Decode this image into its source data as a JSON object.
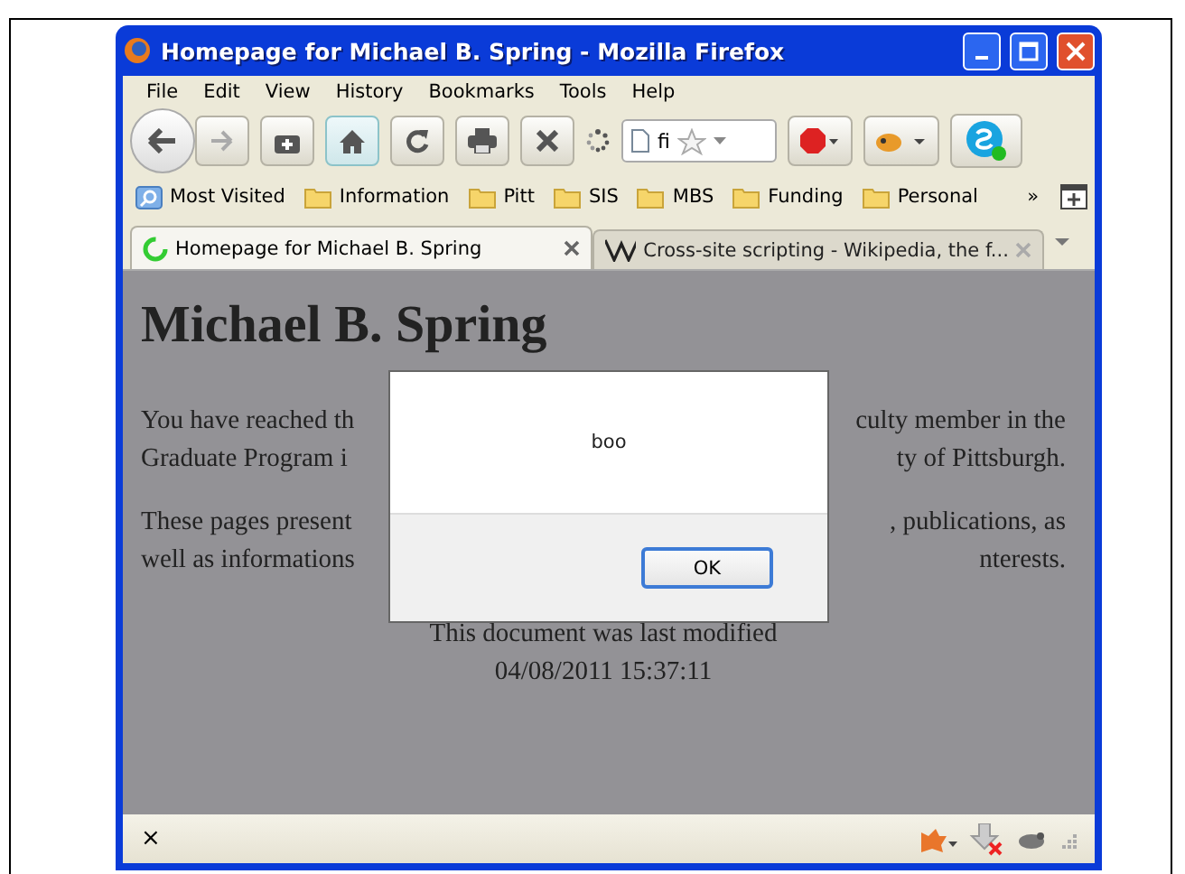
{
  "window": {
    "title": "Homepage for Michael B. Spring - Mozilla Firefox"
  },
  "menu": [
    "File",
    "Edit",
    "View",
    "History",
    "Bookmarks",
    "Tools",
    "Help"
  ],
  "url_bar": {
    "value": "fi"
  },
  "bookmarks": [
    {
      "label": "Most Visited",
      "kind": "smart"
    },
    {
      "label": "Information",
      "kind": "folder"
    },
    {
      "label": "Pitt",
      "kind": "folder"
    },
    {
      "label": "SIS",
      "kind": "folder"
    },
    {
      "label": "MBS",
      "kind": "folder"
    },
    {
      "label": "Funding",
      "kind": "folder"
    },
    {
      "label": "Personal",
      "kind": "folder"
    }
  ],
  "bookmarks_overflow": "»",
  "tabs": [
    {
      "title": "Homepage for Michael B. Spring",
      "kind": "loading",
      "selected": true
    },
    {
      "title": "Cross-site scripting - Wikipedia, the f...",
      "kind": "wiki",
      "selected": false
    }
  ],
  "page": {
    "heading": "Michael B. Spring",
    "lines": [
      {
        "left": "You have reached th",
        "right": "culty member in the"
      },
      {
        "left": "Graduate Program i",
        "right": "ty of Pittsburgh."
      },
      {
        "left": "These pages present",
        "right": ", publications, as",
        "gap": true
      },
      {
        "left": "well as informations",
        "right": "nterests."
      }
    ],
    "footer": [
      "This document was last modified",
      "04/08/2011 15:37:11"
    ]
  },
  "dialog": {
    "message": "boo",
    "button": "OK"
  },
  "status_bar": {
    "close": "×"
  }
}
